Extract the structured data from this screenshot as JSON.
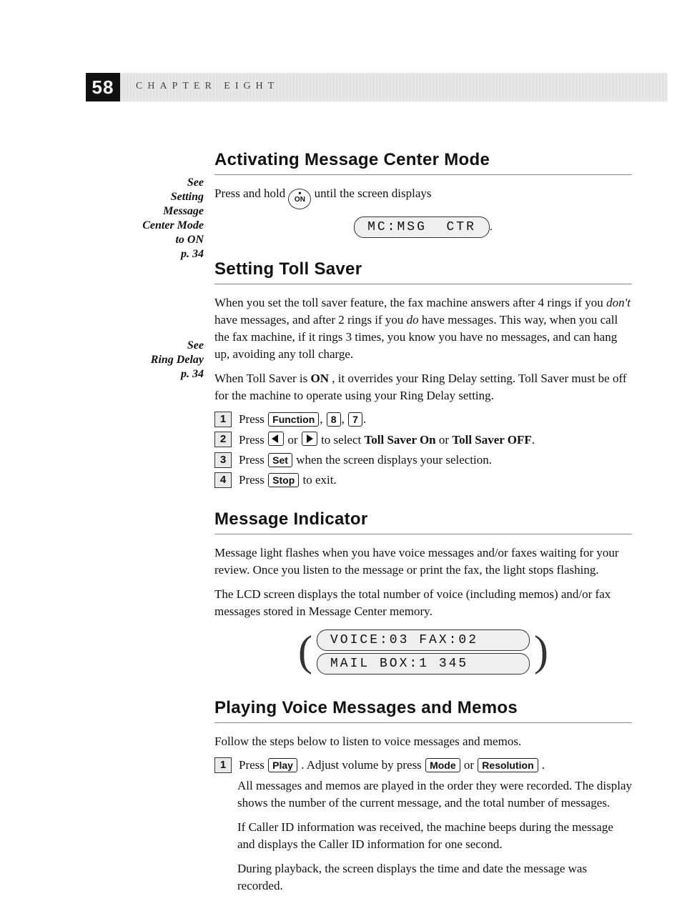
{
  "page_number": "58",
  "chapter_label": "CHAPTER EIGHT",
  "sidebar1": {
    "l1": "See",
    "l2": "Setting",
    "l3": "Message",
    "l4": "Center Mode",
    "l5": "to ON",
    "l6": "p. 34"
  },
  "sidebar2": {
    "l1": "See",
    "l2": "Ring Delay",
    "l3": "p. 34"
  },
  "s1": {
    "title": "Activating Message Center Mode",
    "p1a": "Press and hold ",
    "btn_top": "•",
    "btn_on": "ON",
    "p1b": " until the screen displays",
    "lcd": "MC:MSG  CTR"
  },
  "s2": {
    "title": "Setting Toll Saver",
    "p1a": "When you set the toll saver feature, the fax machine answers after 4 rings if you ",
    "p1_em1": "don't",
    "p1b": " have messages, and after 2 rings if you ",
    "p1_em2": "do",
    "p1c": " have messages. This way, when you call the fax machine, if it rings 3 times, you know you have no messages, and can hang up, avoiding any toll charge.",
    "p2a": "When Toll Saver is ",
    "p2_b": "ON",
    "p2b": ", it overrides your Ring Delay setting. Toll Saver must be off for the machine to operate using your Ring Delay setting.",
    "step1_a": "Press ",
    "k_func": "Function",
    "comma": ", ",
    "k8": "8",
    "k7": "7",
    "dot": ".",
    "step2_a": "Press ",
    "step2_b": " or ",
    "step2_c": " to select ",
    "step2_d": "Toll Saver On",
    "step2_e": " or ",
    "step2_f": "Toll Saver OFF",
    "step3_a": "Press ",
    "k_set": "Set",
    "step3_b": " when the screen displays your selection.",
    "step4_a": "Press ",
    "k_stop": "Stop",
    "step4_b": " to exit.",
    "n1": "1",
    "n2": "2",
    "n3": "3",
    "n4": "4"
  },
  "s3": {
    "title": "Message Indicator",
    "p1": "Message light flashes when you have voice messages and/or faxes waiting for your review. Once you listen to the message or print the fax, the light stops flashing.",
    "p2": "The LCD screen displays the total number of voice (including memos) and/or fax messages stored in Message Center memory.",
    "lcd1": "VOICE:03 FAX:02",
    "lcd2": "MAIL BOX:1 345"
  },
  "s4": {
    "title": "Playing Voice Messages and Memos",
    "p1": "Follow the steps below to listen to voice messages and memos.",
    "n1": "1",
    "step1_a": "Press ",
    "k_play": "Play",
    "step1_b": ". Adjust volume by press ",
    "k_mode": "Mode",
    "step1_c": " or ",
    "k_res": "Resolution",
    "step1_d": ".",
    "p2": "All messages and memos are played in the order they were recorded. The display shows the number of the current message, and the total number of messages.",
    "p3": "If Caller ID information was received, the machine beeps during the message and displays the Caller ID information for one second.",
    "p4": "During playback, the screen displays the time and date the message was recorded."
  }
}
